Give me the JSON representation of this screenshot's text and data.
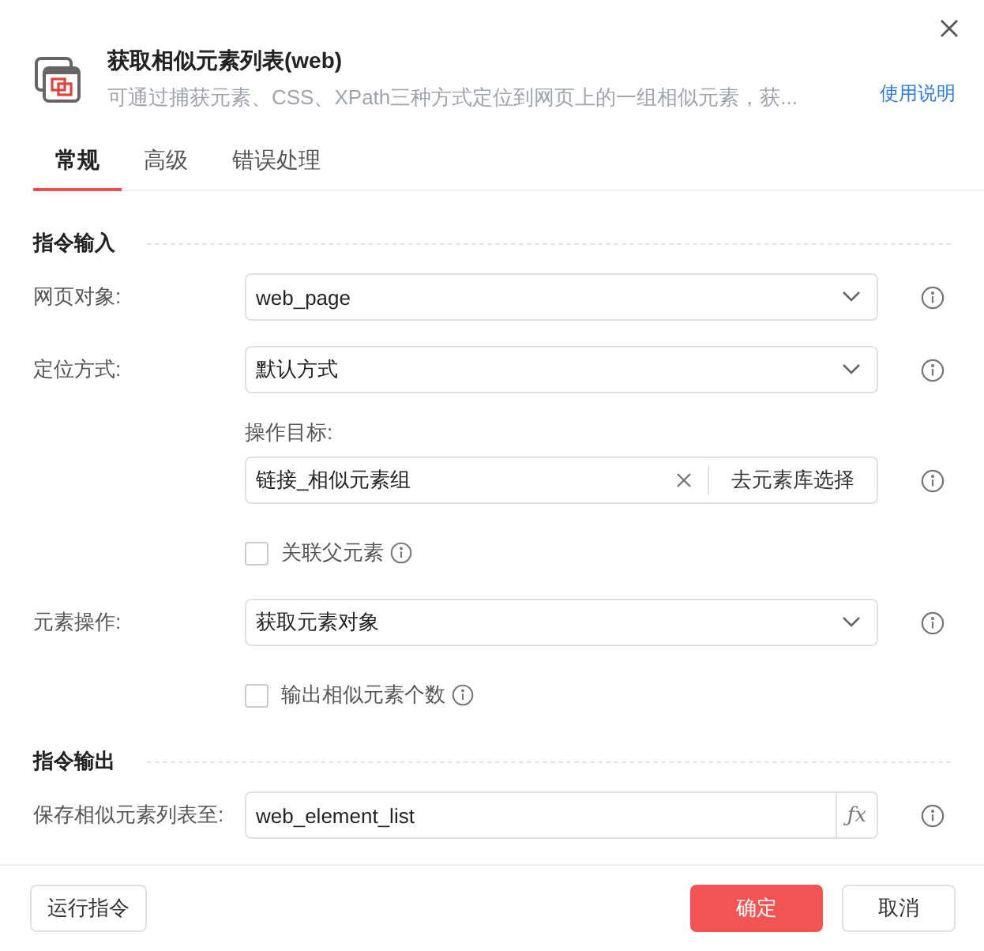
{
  "header": {
    "title": "获取相似元素列表(web)",
    "description": "可通过捕获元素、CSS、XPath三种方式定位到网页上的一组相似元素，获...",
    "help_link": "使用说明"
  },
  "tabs": [
    {
      "label": "常规",
      "selected": true
    },
    {
      "label": "高级",
      "selected": false
    },
    {
      "label": "错误处理",
      "selected": false
    }
  ],
  "sections": [
    {
      "title": "指令输入",
      "rows": [
        {
          "kind": "select",
          "label": "网页对象:",
          "value": "web_page"
        },
        {
          "kind": "select",
          "label": "定位方式:",
          "value": "默认方式"
        },
        {
          "kind": "picker",
          "label": "操作目标:",
          "value": "链接_相似元素组",
          "action": "去元素库选择"
        },
        {
          "kind": "checkbox",
          "label": "关联父元素",
          "checked": false
        },
        {
          "kind": "select",
          "label": "元素操作:",
          "value": "获取元素对象"
        },
        {
          "kind": "checkbox",
          "label": "输出相似元素个数",
          "checked": false
        }
      ]
    },
    {
      "title": "指令输出",
      "rows": [
        {
          "kind": "variable",
          "label": "保存相似元素列表至:",
          "value": "web_element_list",
          "button": "ƒx"
        }
      ]
    }
  ],
  "footer": {
    "run_button": "运行指令",
    "confirm_button": "确定",
    "cancel_button": "取消"
  }
}
